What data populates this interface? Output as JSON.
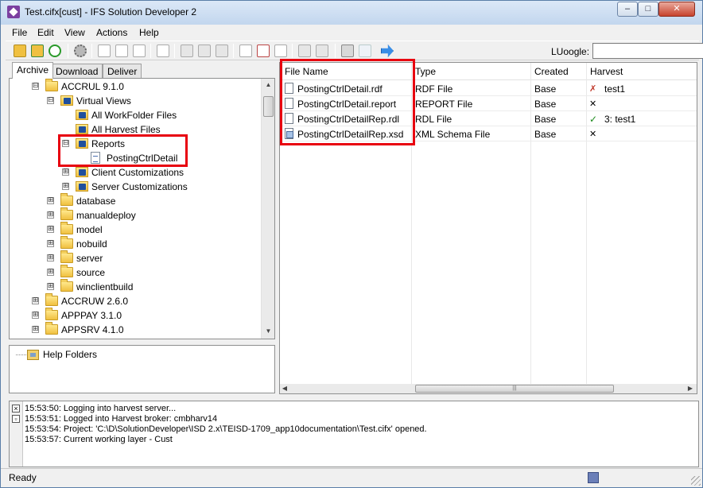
{
  "window": {
    "title": "Test.cifx[cust] - IFS Solution Developer 2",
    "controls": {
      "minimize": "–",
      "maximize": "□",
      "close": "✕"
    }
  },
  "menubar": {
    "items": [
      "File",
      "Edit",
      "View",
      "Actions",
      "Help"
    ]
  },
  "toolbar": {
    "search_label": "LUoogle:",
    "search_value": "",
    "icons": [
      "open-folder-icon",
      "open-folder-green-icon",
      "refresh-icon",
      "settings-icon",
      "blank-page-icon",
      "edit-page-icon",
      "pen-icon",
      "pen-icon",
      "arrow-right-icon",
      "arrow-right-icon",
      "arrow-right-icon",
      "page-icon",
      "page-up-icon",
      "pages-icon",
      "pages-icon",
      "calculator-icon",
      "arrow-left-icon",
      "arrow-right-blue-icon"
    ]
  },
  "left_tabs": [
    "Archive",
    "Download",
    "Deliver"
  ],
  "tree": [
    {
      "label": "ACCRUL 9.1.0",
      "icon": "folder-icon",
      "expander": "⊟",
      "level": 1
    },
    {
      "label": "Virtual Views",
      "icon": "view-icon",
      "expander": "⊟",
      "level": 2
    },
    {
      "label": "All WorkFolder Files",
      "icon": "view-icon",
      "expander": "",
      "level": 3
    },
    {
      "label": "All Harvest Files",
      "icon": "view-icon",
      "expander": "",
      "level": 3
    },
    {
      "label": "Reports",
      "icon": "view-icon",
      "expander": "⊟",
      "level": 3
    },
    {
      "label": "PostingCtrlDetail",
      "icon": "doc-icon",
      "expander": "",
      "level": 4
    },
    {
      "label": "Client Customizations",
      "icon": "view-icon",
      "expander": "⊞",
      "level": 3
    },
    {
      "label": "Server Customizations",
      "icon": "view-icon",
      "expander": "⊞",
      "level": 3
    },
    {
      "label": "database",
      "icon": "folder-icon",
      "expander": "⊞",
      "level": 2
    },
    {
      "label": "manualdeploy",
      "icon": "folder-icon",
      "expander": "⊞",
      "level": 2
    },
    {
      "label": "model",
      "icon": "folder-icon",
      "expander": "⊞",
      "level": 2
    },
    {
      "label": "nobuild",
      "icon": "folder-icon",
      "expander": "⊞",
      "level": 2
    },
    {
      "label": "server",
      "icon": "folder-icon",
      "expander": "⊞",
      "level": 2
    },
    {
      "label": "source",
      "icon": "folder-icon",
      "expander": "⊞",
      "level": 2
    },
    {
      "label": "winclientbuild",
      "icon": "folder-icon",
      "expander": "⊞",
      "level": 2
    },
    {
      "label": "ACCRUW 2.6.0",
      "icon": "folder-icon",
      "expander": "⊞",
      "level": 1
    },
    {
      "label": "APPPAY 3.1.0",
      "icon": "folder-icon",
      "expander": "⊞",
      "level": 1
    },
    {
      "label": "APPSRV 4.1.0",
      "icon": "folder-icon",
      "expander": "⊞",
      "level": 1
    }
  ],
  "help_folders": {
    "label": "Help Folders"
  },
  "files_grid": {
    "columns": [
      "File Name",
      "Type",
      "Created",
      "Harvest"
    ],
    "rows": [
      {
        "name": "PostingCtrlDetail.rdf",
        "type": "RDF File",
        "created": "Base",
        "harvest_mark": "✗",
        "harvest_text": "test1",
        "icon": "file-icon"
      },
      {
        "name": "PostingCtrlDetail.report",
        "type": "REPORT File",
        "created": "Base",
        "harvest_mark": "✕",
        "harvest_text": "",
        "icon": "file-icon"
      },
      {
        "name": "PostingCtrlDetailRep.rdl",
        "type": "RDL File",
        "created": "Base",
        "harvest_mark": "✓",
        "harvest_text": "3: test1",
        "icon": "file-icon"
      },
      {
        "name": "PostingCtrlDetailRep.xsd",
        "type": "XML Schema File",
        "created": "Base",
        "harvest_mark": "✕",
        "harvest_text": "",
        "icon": "xsd-file-icon"
      }
    ]
  },
  "log": {
    "lines": [
      "15:53:50: Logging into harvest server...",
      "15:53:51: Logged into Harvest broker: cmbharv14",
      "15:53:54: Project: 'C:\\D\\SolutionDeveloper\\ISD 2.x\\TEISD-1709_app10documentation\\Test.cifx' opened.",
      "15:53:57: Current working layer - Cust"
    ]
  },
  "status": {
    "text": "Ready"
  },
  "colors": {
    "highlight_box": "#e8000f",
    "check": "#1b8a1b"
  }
}
